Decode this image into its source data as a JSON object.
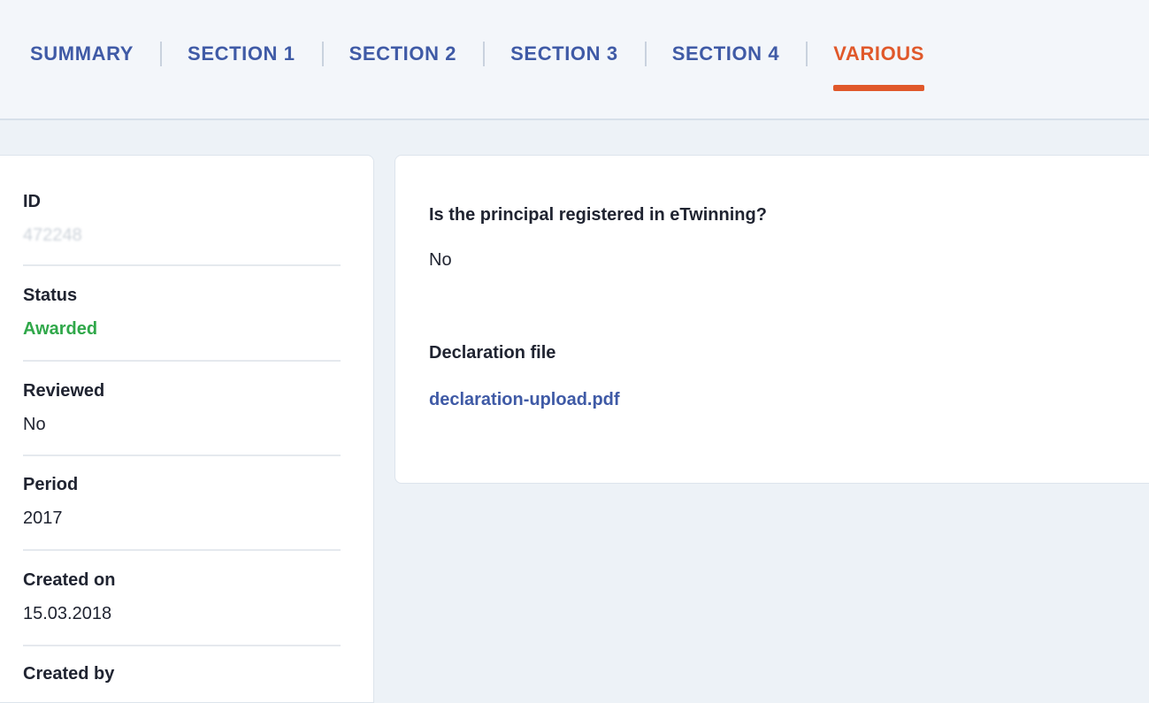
{
  "tabs": [
    {
      "label": "SUMMARY",
      "active": false
    },
    {
      "label": "SECTION 1",
      "active": false
    },
    {
      "label": "SECTION 2",
      "active": false
    },
    {
      "label": "SECTION 3",
      "active": false
    },
    {
      "label": "SECTION 4",
      "active": false
    },
    {
      "label": "VARIOUS",
      "active": true
    }
  ],
  "info": {
    "id_label": "ID",
    "id_value": "472248",
    "status_label": "Status",
    "status_value": "Awarded",
    "reviewed_label": "Reviewed",
    "reviewed_value": "No",
    "period_label": "Period",
    "period_value": "2017",
    "created_on_label": "Created on",
    "created_on_value": "15.03.2018",
    "created_by_label": "Created by"
  },
  "various": {
    "principal_question": "Is the principal registered in eTwinning?",
    "principal_answer": "No",
    "declaration_label": "Declaration file",
    "declaration_file": "declaration-upload.pdf"
  },
  "colors": {
    "accent": "#e0582a",
    "link": "#3f5aa6",
    "success": "#30a84a",
    "background": "#edf2f7"
  }
}
